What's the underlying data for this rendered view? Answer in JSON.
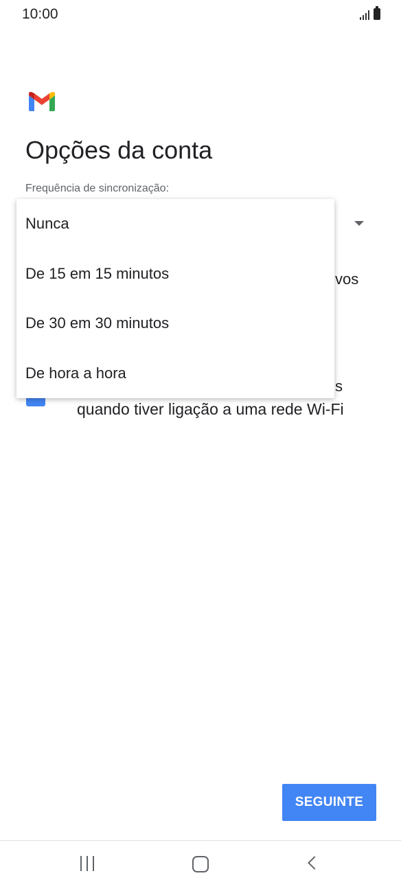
{
  "status_bar": {
    "time": "10:00"
  },
  "page": {
    "title": "Opções da conta",
    "sync_label": "Frequência de sincronização:",
    "peek_text_1": "vos",
    "peek_text_2": "s",
    "wifi_text": "quando tiver ligação a uma rede Wi-Fi"
  },
  "dropdown": {
    "options": [
      "Nunca",
      "De 15 em 15 minutos",
      "De 30 em 30 minutos",
      "De hora a hora"
    ]
  },
  "footer": {
    "next_label": "SEGUINTE"
  },
  "colors": {
    "accent": "#4285f4",
    "text": "#202124",
    "secondary_text": "#5f6368"
  }
}
